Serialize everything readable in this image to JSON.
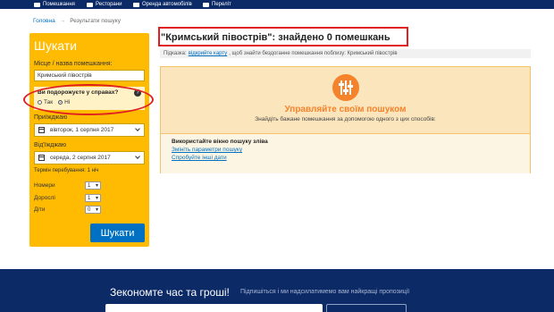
{
  "nav": {
    "items": [
      {
        "label": "Помешкання",
        "icon": "bed-icon"
      },
      {
        "label": "Ресторани",
        "icon": "restaurant-icon"
      },
      {
        "label": "Оренда автомобілів",
        "icon": "car-icon"
      },
      {
        "label": "Переліт",
        "icon": "plane-icon"
      }
    ]
  },
  "breadcrumb": {
    "home": "Головна",
    "separator": "→",
    "current": "Результати пошуку"
  },
  "sidebar": {
    "title": "Шукати",
    "destination_label": "Місце / назва помешкання:",
    "destination_value": "Кримський півострів",
    "business_question": "Ви подорожуєте у справах?",
    "business_yes": "Так",
    "business_no": "Ні",
    "business_selected": "Ні",
    "checkin_label": "Приїжджаю",
    "checkin_value": "вівторок, 1 серпня 2017",
    "checkout_label": "Від'їжджаю",
    "checkout_value": "середа, 2 серпня 2017",
    "stay_length": "Термін перебування: 1 ніч",
    "rooms_label": "Номери",
    "rooms_value": "1",
    "adults_label": "Дорослі",
    "adults_value": "1",
    "children_label": "Діти",
    "children_value": "0",
    "search_button": "Шукати"
  },
  "results": {
    "title": "\"Кримський півострів\": знайдено 0 помешкань",
    "hint_prefix": "Підказка:",
    "hint_link": "відкрийте карту",
    "hint_suffix": ", щоб знайти бездоганне помешкання поблизу: Кримський півострів"
  },
  "manage": {
    "title": "Управляйте своїм пошуком",
    "subtitle": "Знайдіть бажане помешкання за допомогою одного з цих способів:",
    "side_search": "Використайте вікно пошуку зліва",
    "change_params": "Змініть параметри пошуку",
    "try_other_dates": "Спробуйте інші дати"
  },
  "footer": {
    "headline": "Зекономте час та гроші!",
    "subscribe_text": "Підпишіться і ми надсилатимемо вам найкращі пропозиції"
  },
  "colors": {
    "navy": "#0b2a66",
    "sidebar_yellow": "#febb02",
    "accent_orange": "#f5832b",
    "link_blue": "#0071c2",
    "annotation_red": "#e02020"
  }
}
